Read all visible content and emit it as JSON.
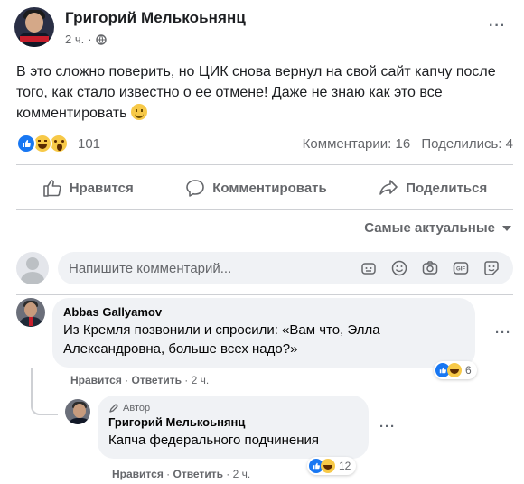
{
  "post": {
    "author": "Григорий Мелькоьнянц",
    "time": "2 ч.",
    "text": "В это сложно поверить, но ЦИК снова вернул на свой сайт капчу после того, как стало известно о ее отмене! Даже не знаю как это все комментировать",
    "reaction_count": "101",
    "comments_stat": "Комментарии: 16",
    "shares_stat": "Поделились: 4"
  },
  "actions": {
    "like": "Нравится",
    "comment": "Комментировать",
    "share": "Поделиться"
  },
  "sort_label": "Самые актуальные",
  "composer": {
    "placeholder": "Напишите комментарий..."
  },
  "comments": [
    {
      "name": "Abbas Gallyamov",
      "text_line1": "Из Кремля позвонили и спросили: «Вам что, Элла",
      "text_line2": "Александровна, больше всех надо?»",
      "like_label": "Нравится",
      "reply_label": "Ответить",
      "time": "2 ч.",
      "reactions": "6"
    },
    {
      "badge": "Автор",
      "name": "Григорий Мелькоьнянц",
      "text": "Капча федерального подчинения",
      "like_label": "Нравится",
      "reply_label": "Ответить",
      "time": "2 ч.",
      "reactions": "12"
    }
  ],
  "colors": {
    "like_blue": "#1877f2",
    "reaction_yellow": "#f7c948",
    "muted_text": "#65676b",
    "bubble_bg": "#f0f2f5"
  },
  "icons": [
    "globe-icon",
    "like-icon",
    "haha-icon",
    "wow-icon",
    "thumbs-up-icon",
    "comment-icon",
    "share-icon",
    "sticker-icon",
    "emoji-icon",
    "camera-icon",
    "gif-icon",
    "sticker-face-icon",
    "pencil-icon"
  ]
}
